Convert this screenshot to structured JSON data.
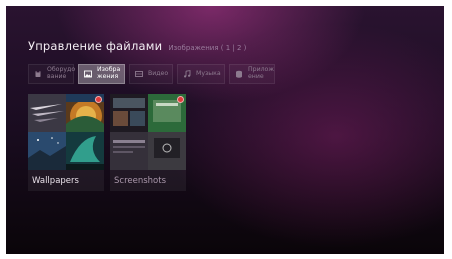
{
  "header": {
    "title": "Управление файлами",
    "subtitle": "Изображения ( 1 | 2 )"
  },
  "tabs": [
    {
      "label": "Оборудо\nвание",
      "icon": "storage-icon",
      "active": false
    },
    {
      "label": "Изобра\nжения",
      "icon": "image-icon",
      "active": true
    },
    {
      "label": "Видео",
      "icon": "video-icon",
      "active": false
    },
    {
      "label": "Музыка",
      "icon": "music-icon",
      "active": false
    },
    {
      "label": "Прилож\nение",
      "icon": "app-icon",
      "active": false
    }
  ],
  "folders": [
    {
      "name": "Wallpapers",
      "badge": true
    },
    {
      "name": "Screenshots",
      "badge": true
    }
  ],
  "colors": {
    "accent_badge": "#e03a3a",
    "title": "#f4eef4",
    "inactive_text": "#8d7b8f"
  }
}
